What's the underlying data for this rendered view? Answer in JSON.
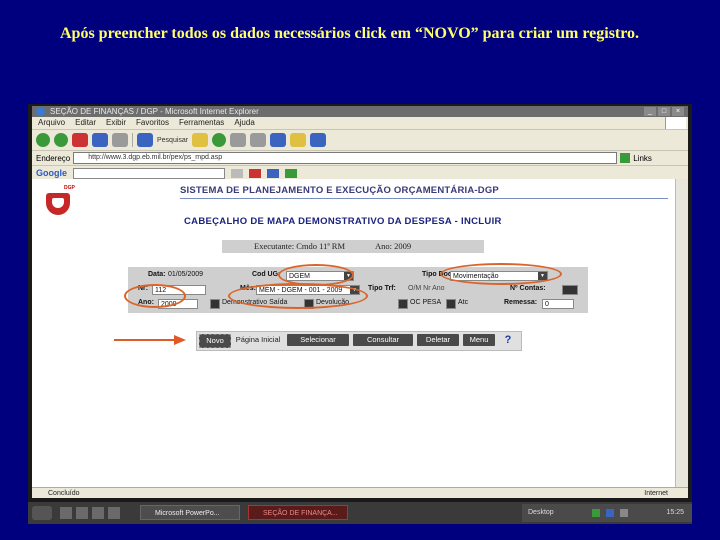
{
  "slide": {
    "instruction": "Após preencher todos os dados necessários click em “NOVO” para criar um registro."
  },
  "browser": {
    "title": "SEÇÃO DE FINANÇAS / DGP - Microsoft Internet Explorer",
    "menu": [
      "Arquivo",
      "Editar",
      "Exibir",
      "Favoritos",
      "Ferramentas",
      "Ajuda"
    ],
    "address_label": "Endereço",
    "url": "http://www.3.dgp.eb.mil.br/pex/ps_mpd.asp",
    "links_label": "Links",
    "google_label": "Google",
    "search_label": "Pesquisar",
    "status_text": "Concluído",
    "zone_text": "Internet"
  },
  "app": {
    "logo_text": "DGP",
    "system_title": "SISTEMA DE PLANEJAMENTO E EXECUÇÃO ORÇAMENTÁRIA-DGP",
    "page_title": "CABEÇALHO DE MAPA DEMONSTRATIVO DA DESPESA - INCLUIR",
    "executante": "Executante: Cmdo 11ª RM",
    "ano_exec": "Ano: 2009"
  },
  "form": {
    "data_label": "Data:",
    "data_value": "01/05/2009",
    "codug_label": "Cod UG:",
    "codug_value": "DGEM",
    "tipo_doc_label": "Tipo Doc:",
    "tipo_doc_value": "Movimentação",
    "nr_label": "Nr:",
    "nr_value": "112",
    "mes_label": "Mês:",
    "mes_value": "MEM - DGEM - 001 - 2009",
    "tipo_label": "Tipo Trf:",
    "tipo_value": "O/M   Nr   Ano",
    "cont_label": "Nº Contas:",
    "ano_label": "Ano:",
    "ano_value": "2009",
    "demonstr_label": "Demonstrativo Saída",
    "devolucao_label": "Devolução",
    "oc_label": "OC PESA",
    "atc_label": "Atc",
    "remessa_label": "Remessa:",
    "remessa_value": "0"
  },
  "buttons": {
    "novo": "Novo",
    "pagina_inicial": "Página Inicial",
    "selecionar": "Selecionar",
    "consultar": "Consultar",
    "deletar": "Deletar",
    "menu": "Menu"
  },
  "taskbar": {
    "task1": "Microsoft PowerPo...",
    "task2": "SEÇÃO DE FINANÇA...",
    "lang": "Desktop",
    "clock": "15:25"
  },
  "colors": {
    "slide_bg": "#00007f",
    "instruction_text": "#ffff66",
    "highlight_ring": "#d9652b"
  }
}
